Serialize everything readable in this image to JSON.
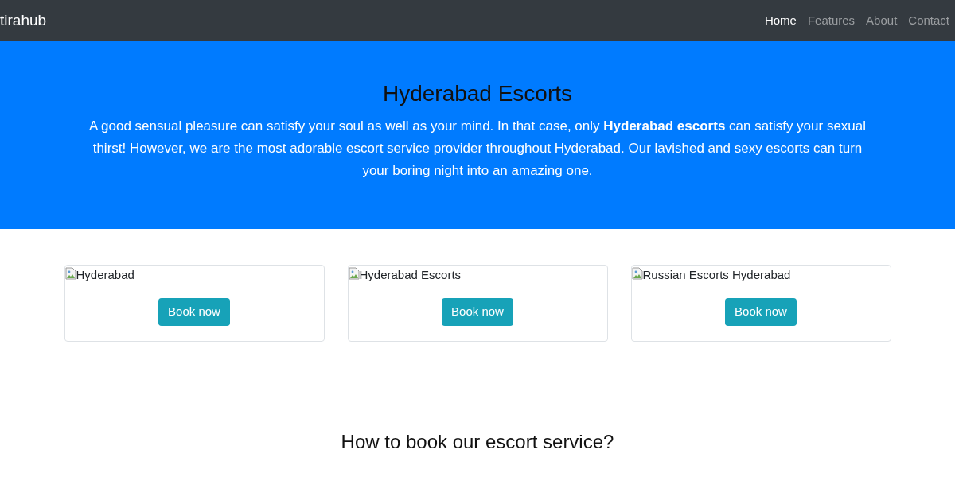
{
  "navbar": {
    "brand": "tirahub",
    "links": [
      {
        "label": "Home",
        "selected": true
      },
      {
        "label": "Features",
        "selected": false
      },
      {
        "label": "About",
        "selected": false
      },
      {
        "label": "Contact",
        "selected": false
      }
    ]
  },
  "hero": {
    "title": "Hyderabad Escorts",
    "text": "A good sensual pleasure can satisfy your soul as well as your mind. In that case, only **Hyderabad escorts** can satisfy your sexual thirst! However, we are the most adorable escort service provider throughout Hyderabad. Our lavished and sexy escorts can turn your boring night into an amazing one."
  },
  "cards": [
    {
      "image_alt": "Hyderabad",
      "button": "Book now"
    },
    {
      "image_alt": "Hyderabad Escorts",
      "button": "Book now"
    },
    {
      "image_alt": "Russian Escorts Hyderabad",
      "button": "Book now"
    }
  ],
  "section": {
    "heading": "How to book our escort service?"
  }
}
